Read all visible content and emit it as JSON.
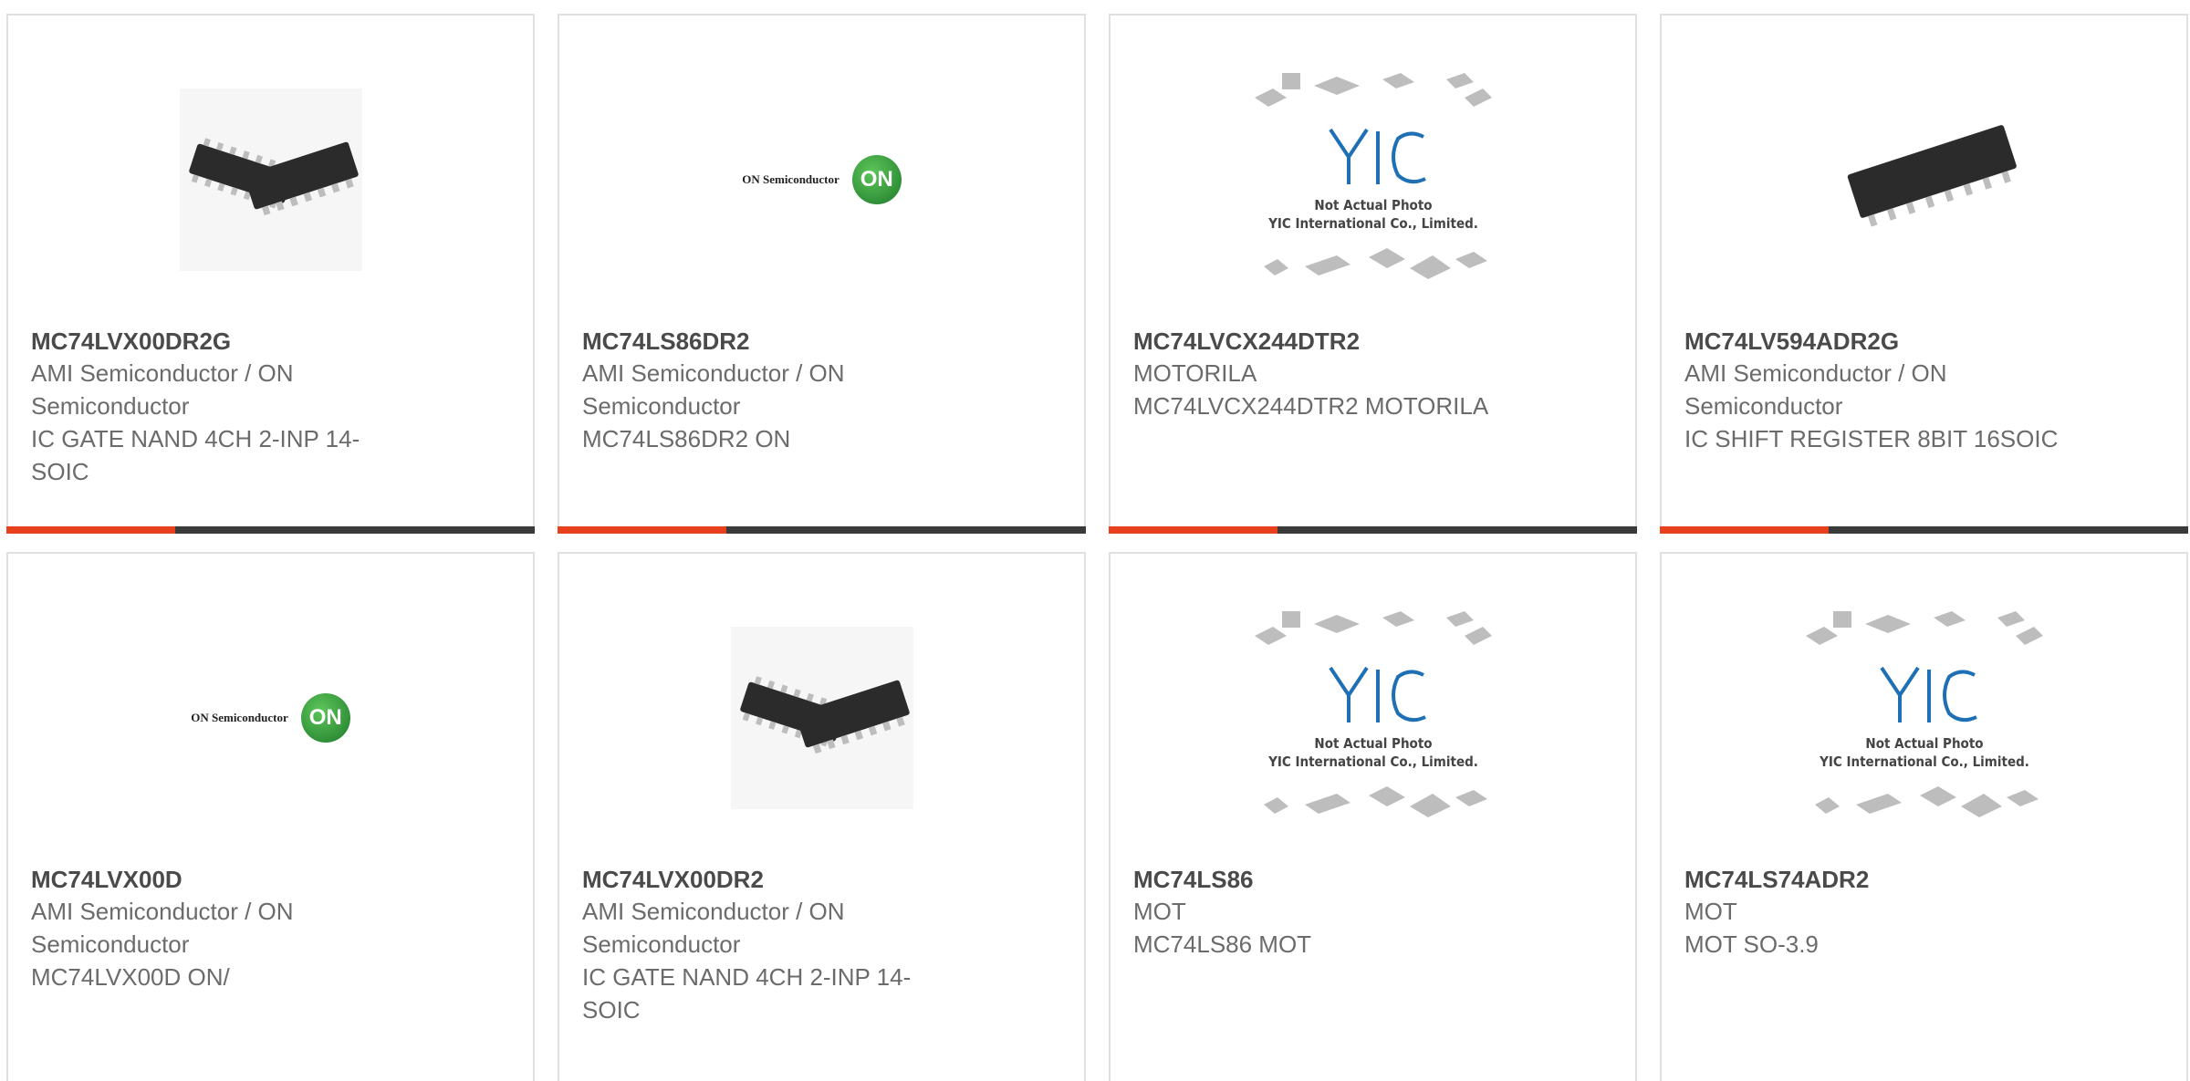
{
  "colors": {
    "accent": "#e8401c",
    "bar": "#3a3a3a",
    "yic_blue": "#1f6fb5",
    "on_green": "#2e9a3a"
  },
  "products": [
    {
      "part": "MC74LVX00DR2G",
      "manufacturer": "AMI Semiconductor / ON Semiconductor",
      "description": "IC GATE NAND 4CH 2-INP 14-SOIC",
      "image": "soic-14-pair-photo"
    },
    {
      "part": "MC74LS86DR2",
      "manufacturer": "AMI Semiconductor / ON Semiconductor",
      "description": "MC74LS86DR2 ON",
      "image": "on-semiconductor-logo"
    },
    {
      "part": "MC74LVCX244DTR2",
      "manufacturer": "MOTORILA",
      "description": "MC74LVCX244DTR2 MOTORILA",
      "image": "yic-not-actual-photo"
    },
    {
      "part": "MC74LV594ADR2G",
      "manufacturer": "AMI Semiconductor / ON Semiconductor",
      "description": "IC SHIFT REGISTER 8BIT 16SOIC",
      "image": "soic-16-photo"
    },
    {
      "part": "MC74LVX00D",
      "manufacturer": "AMI Semiconductor / ON Semiconductor",
      "description": "MC74LVX00D ON/",
      "image": "on-semiconductor-logo"
    },
    {
      "part": "MC74LVX00DR2",
      "manufacturer": "AMI Semiconductor / ON Semiconductor",
      "description": "IC GATE NAND 4CH 2-INP 14-SOIC",
      "image": "soic-14-pair-photo"
    },
    {
      "part": "MC74LS86",
      "manufacturer": "MOT",
      "description": "MC74LS86 MOT",
      "image": "yic-not-actual-photo"
    },
    {
      "part": "MC74LS74ADR2",
      "manufacturer": "MOT",
      "description": "MOT SO-3.9",
      "image": "yic-not-actual-photo"
    }
  ],
  "logos": {
    "on_text": "ON Semiconductor",
    "on_mark": "ON",
    "yic_mark": "YIC",
    "yic_line1": "Not Actual Photo",
    "yic_line2": "YIC International Co., Limited."
  }
}
